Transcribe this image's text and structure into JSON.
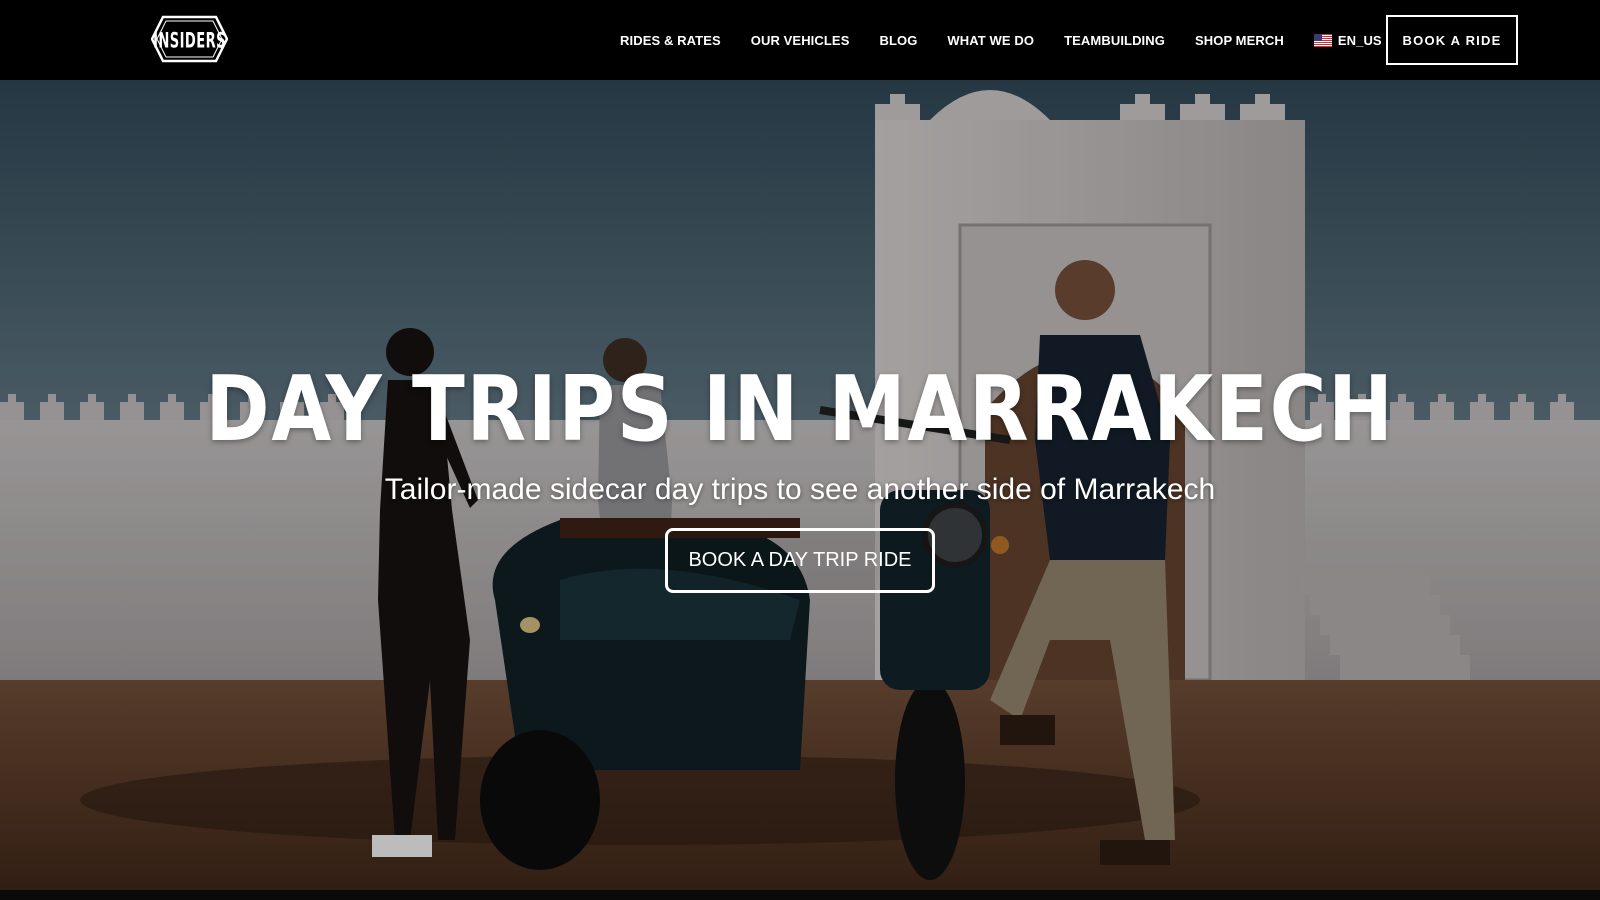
{
  "brand": {
    "logo_text": "INSIDERS"
  },
  "nav": {
    "items": [
      {
        "label": "RIDES & RATES"
      },
      {
        "label": "OUR VEHICLES"
      },
      {
        "label": "BLOG"
      },
      {
        "label": "WHAT WE DO"
      },
      {
        "label": "TEAMBUILDING"
      },
      {
        "label": "SHOP MERCH"
      }
    ],
    "language": {
      "label": "EN_US",
      "icon": "us-flag-icon"
    },
    "book_label": "BOOK A RIDE"
  },
  "hero": {
    "title": "DAY TRIPS IN MARRAKECH",
    "subtitle": "Tailor-made sidecar day trips to see another side of Marrakech",
    "cta_label": "BOOK A DAY TRIP RIDE"
  },
  "colors": {
    "header_bg": "#000000",
    "text": "#ffffff",
    "sky": "#3f5866",
    "wall": "#d9d4ce",
    "ground": "#5a3a26"
  }
}
